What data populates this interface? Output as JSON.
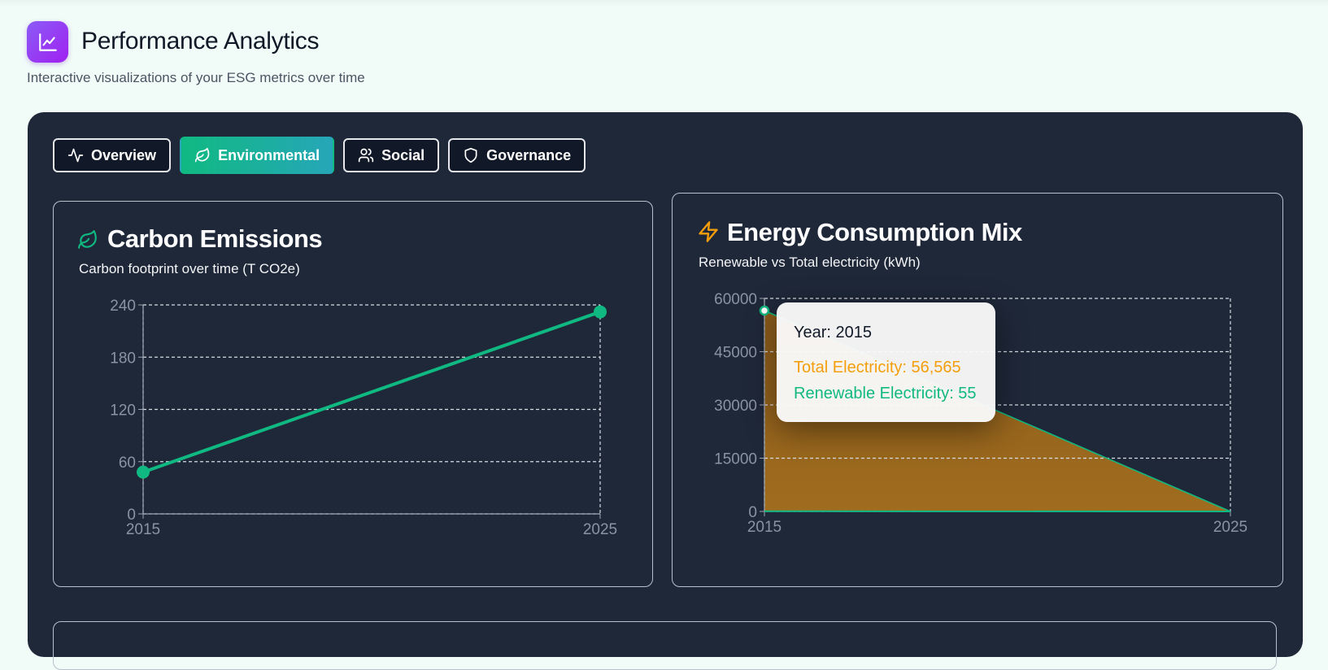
{
  "header": {
    "title": "Performance Analytics",
    "subtitle": "Interactive visualizations of your ESG metrics over time",
    "icon": "line-chart-icon"
  },
  "tabs": [
    {
      "label": "Overview",
      "icon": "activity-icon",
      "active": false
    },
    {
      "label": "Environmental",
      "icon": "leaf-icon",
      "active": true
    },
    {
      "label": "Social",
      "icon": "users-icon",
      "active": false
    },
    {
      "label": "Governance",
      "icon": "shield-icon",
      "active": false
    }
  ],
  "carbon": {
    "title": "Carbon Emissions",
    "subtitle": "Carbon footprint over time (T CO2e)",
    "icon": "leaf-icon"
  },
  "energy": {
    "title": "Energy Consumption Mix",
    "subtitle": "Renewable vs Total electricity (kWh)",
    "icon": "lightning-icon"
  },
  "tooltip": {
    "year": "Year: 2015",
    "total": "Total Electricity: 56,565",
    "renewable": "Renewable Electricity: 55"
  },
  "colors": {
    "accent": "#10b981",
    "total": "#f59e0b",
    "renewable": "#10b981",
    "panel": "#1f2839",
    "page_bg": "#f1fbf8"
  },
  "chart_data": [
    {
      "type": "line",
      "title": "Carbon Emissions",
      "x": [
        "2015",
        "2025"
      ],
      "series": [
        {
          "values": [
            48,
            232
          ]
        }
      ],
      "y_ticks": [
        "0",
        "60",
        "120",
        "180",
        "240"
      ],
      "ylim": [
        0,
        240
      ],
      "grid": true
    },
    {
      "type": "area",
      "title": "Energy Consumption Mix",
      "x": [
        "2015",
        "2025"
      ],
      "series": [
        {
          "name": "Total Electricity",
          "values": [
            56565,
            0
          ],
          "color": "#f59e0b"
        },
        {
          "name": "Renewable Electricity",
          "values": [
            55,
            0
          ],
          "color": "#10b981"
        }
      ],
      "y_ticks": [
        "0",
        "15000",
        "30000",
        "45000",
        "60000"
      ],
      "ylim": [
        0,
        60000
      ],
      "grid": true
    }
  ]
}
